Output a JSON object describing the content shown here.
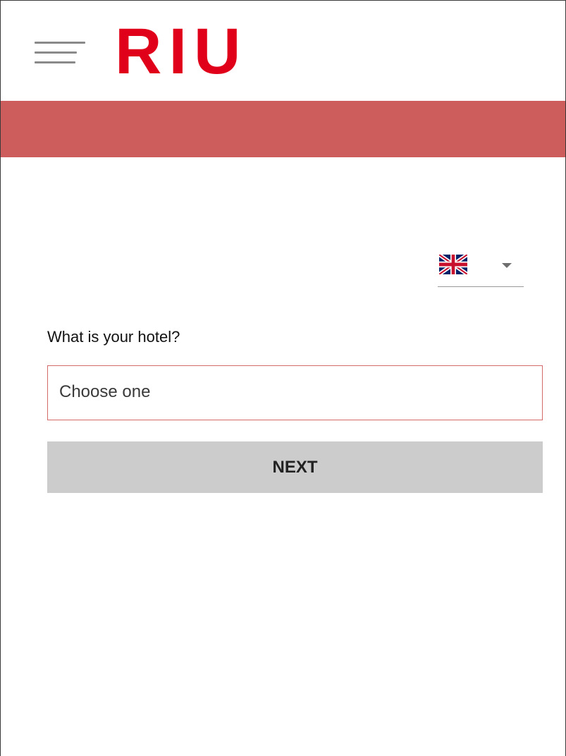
{
  "header": {
    "menu_icon": "hamburger-menu-icon",
    "logo_text": "RIU"
  },
  "language": {
    "selected": "English (UK)",
    "flag_icon": "uk-flag-icon",
    "caret_icon": "caret-down-icon"
  },
  "form": {
    "question": "What is your hotel?",
    "hotel_select_placeholder": "Choose one",
    "next_label": "NEXT"
  },
  "colors": {
    "brand_red": "#e1001a",
    "band": "#cd5c5c",
    "select_border": "#d56a6a",
    "button_bg": "#cccccc"
  }
}
